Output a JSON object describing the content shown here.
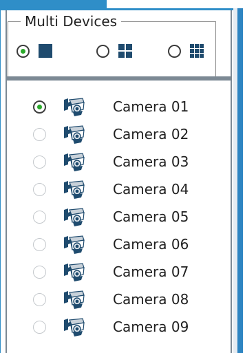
{
  "group": {
    "title": "Multi Devices",
    "layouts": [
      {
        "name": "single",
        "selected": true
      },
      {
        "name": "quad",
        "selected": false
      },
      {
        "name": "nine",
        "selected": false
      }
    ]
  },
  "cameras": [
    {
      "label": "Camera 01",
      "selected": true
    },
    {
      "label": "Camera 02",
      "selected": false
    },
    {
      "label": "Camera 03",
      "selected": false
    },
    {
      "label": "Camera 04",
      "selected": false
    },
    {
      "label": "Camera 05",
      "selected": false
    },
    {
      "label": "Camera 06",
      "selected": false
    },
    {
      "label": "Camera 07",
      "selected": false
    },
    {
      "label": "Camera 08",
      "selected": false
    },
    {
      "label": "Camera 09",
      "selected": false
    }
  ],
  "colors": {
    "accent": "#2f8ec8",
    "radio_checked": "#2aaa2a",
    "icon": "#1f4b6e"
  },
  "icons": [
    "single-view-icon",
    "quad-view-icon",
    "nine-view-icon",
    "security-camera-icon"
  ]
}
